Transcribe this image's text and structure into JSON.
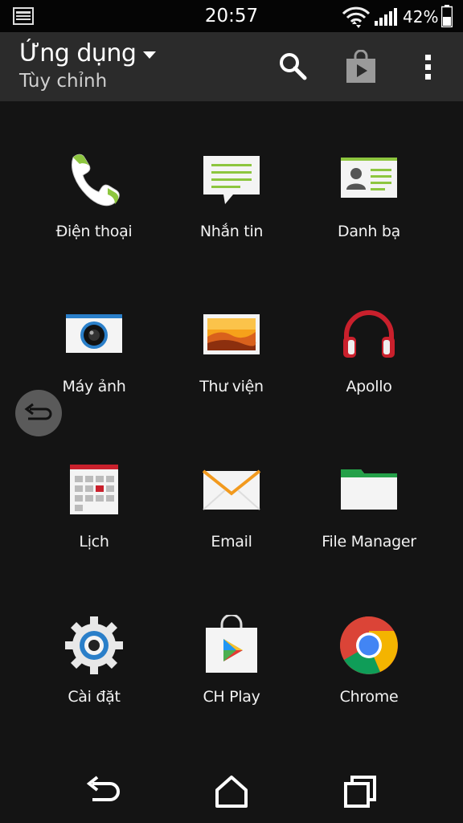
{
  "status_bar": {
    "time": "20:57",
    "battery_percent": "42%",
    "icons": [
      "notification-icon",
      "wifi-icon",
      "signal-icon",
      "battery-icon"
    ]
  },
  "header": {
    "title": "Ứng dụng",
    "subtitle": "Tùy chỉnh",
    "actions": [
      "search-icon",
      "play-store-icon",
      "overflow-menu-icon"
    ]
  },
  "apps": [
    {
      "label": "Điện thoại",
      "icon": "phone-icon"
    },
    {
      "label": "Nhắn tin",
      "icon": "messages-icon"
    },
    {
      "label": "Danh bạ",
      "icon": "contacts-icon"
    },
    {
      "label": "Máy ảnh",
      "icon": "camera-icon"
    },
    {
      "label": "Thư viện",
      "icon": "gallery-icon"
    },
    {
      "label": "Apollo",
      "icon": "headphones-icon"
    },
    {
      "label": "Lịch",
      "icon": "calendar-icon"
    },
    {
      "label": "Email",
      "icon": "email-icon"
    },
    {
      "label": "File Manager",
      "icon": "folder-icon"
    },
    {
      "label": "Cài đặt",
      "icon": "settings-icon"
    },
    {
      "label": "CH Play",
      "icon": "play-store-bag-icon"
    },
    {
      "label": "Chrome",
      "icon": "chrome-icon"
    }
  ],
  "nav": [
    "back-icon",
    "home-icon",
    "recents-icon"
  ],
  "colors": {
    "background": "#141414",
    "header": "#2b2b2b",
    "accent_green": "#8dc63f"
  }
}
